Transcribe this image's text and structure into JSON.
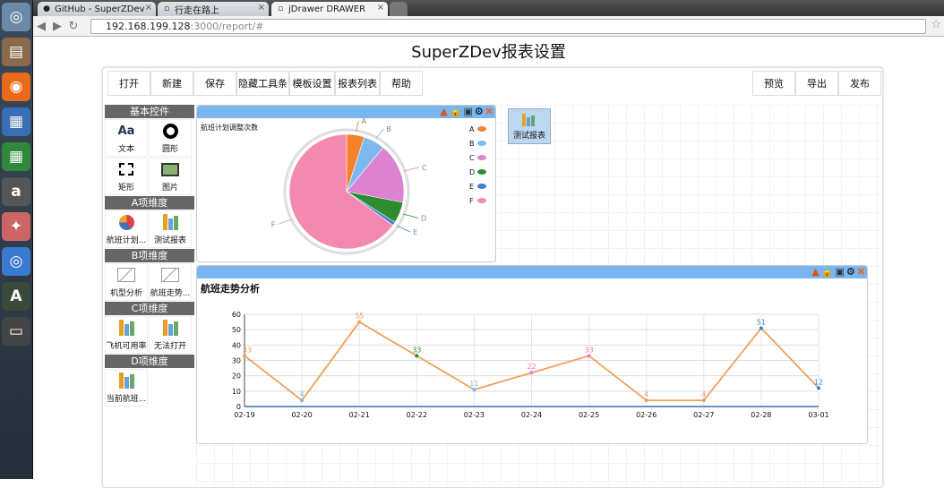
{
  "browser": {
    "tabs": [
      {
        "title": "GitHub - SuperZDev",
        "icon": "github-icon"
      },
      {
        "title": "行走在路上",
        "icon": "page-icon"
      },
      {
        "title": "jDrawer DRAWER",
        "icon": "drawer-icon"
      }
    ],
    "url_host": "192.168.199.128",
    "url_path": ":3000/report/#"
  },
  "page": {
    "title": "SuperZDev报表设置"
  },
  "toolbar": {
    "left": [
      "打开",
      "新建",
      "保存",
      "隐藏工具条",
      "模板设置",
      "报表列表",
      "帮助"
    ],
    "right": [
      "预览",
      "导出",
      "发布"
    ]
  },
  "palette": {
    "sections": [
      {
        "title": "基本控件",
        "items": [
          {
            "label": "文本",
            "icon": "text-icon"
          },
          {
            "label": "圆形",
            "icon": "circle-icon"
          },
          {
            "label": "矩形",
            "icon": "rectangle-icon"
          },
          {
            "label": "图片",
            "icon": "image-icon"
          }
        ]
      },
      {
        "title": "A项维度",
        "items": [
          {
            "label": "航班计划...",
            "icon": "pie-chart-icon"
          },
          {
            "label": "测试报表",
            "icon": "bar-chart-icon"
          }
        ]
      },
      {
        "title": "B项维度",
        "items": [
          {
            "label": "机型分析",
            "icon": "line-chart-icon"
          },
          {
            "label": "航班走势...",
            "icon": "line-chart-icon"
          }
        ]
      },
      {
        "title": "C项维度",
        "items": [
          {
            "label": "飞机可用率",
            "icon": "bar-chart-icon"
          },
          {
            "label": "无法打开",
            "icon": "bar-chart-icon"
          }
        ]
      },
      {
        "title": "D项维度",
        "items": [
          {
            "label": "当前航班...",
            "icon": "bar-chart-icon"
          }
        ]
      }
    ]
  },
  "shortcut": {
    "label": "测试报表",
    "icon": "bar-chart-icon"
  },
  "widget_icons": [
    "warning-icon",
    "unlock-icon",
    "panel-icon",
    "gear-icon",
    "close-icon"
  ],
  "colors": {
    "header": "#79b5ee",
    "line": "#f0a05a"
  },
  "chart_data": [
    {
      "type": "pie",
      "title": "航班计划调整次数",
      "categories": [
        "A",
        "B",
        "C",
        "D",
        "E",
        "F"
      ],
      "values": [
        5,
        6,
        17,
        6,
        1,
        65
      ],
      "colors": [
        "#f5812a",
        "#7db8f0",
        "#dc82d0",
        "#2e8b2e",
        "#3a7fd0",
        "#f489b0"
      ],
      "legend": "right"
    },
    {
      "type": "line",
      "title": "航班走势分析",
      "categories": [
        "02-19",
        "02-20",
        "02-21",
        "02-22",
        "02-23",
        "02-24",
        "02-25",
        "02-26",
        "02-27",
        "02-28",
        "03-01"
      ],
      "values": [
        33,
        4,
        55,
        33,
        11,
        22,
        33,
        4,
        4,
        51,
        12
      ],
      "ylim": [
        0,
        60
      ],
      "yticks": [
        0,
        10,
        20,
        30,
        40,
        50,
        60
      ],
      "grid": true
    }
  ]
}
